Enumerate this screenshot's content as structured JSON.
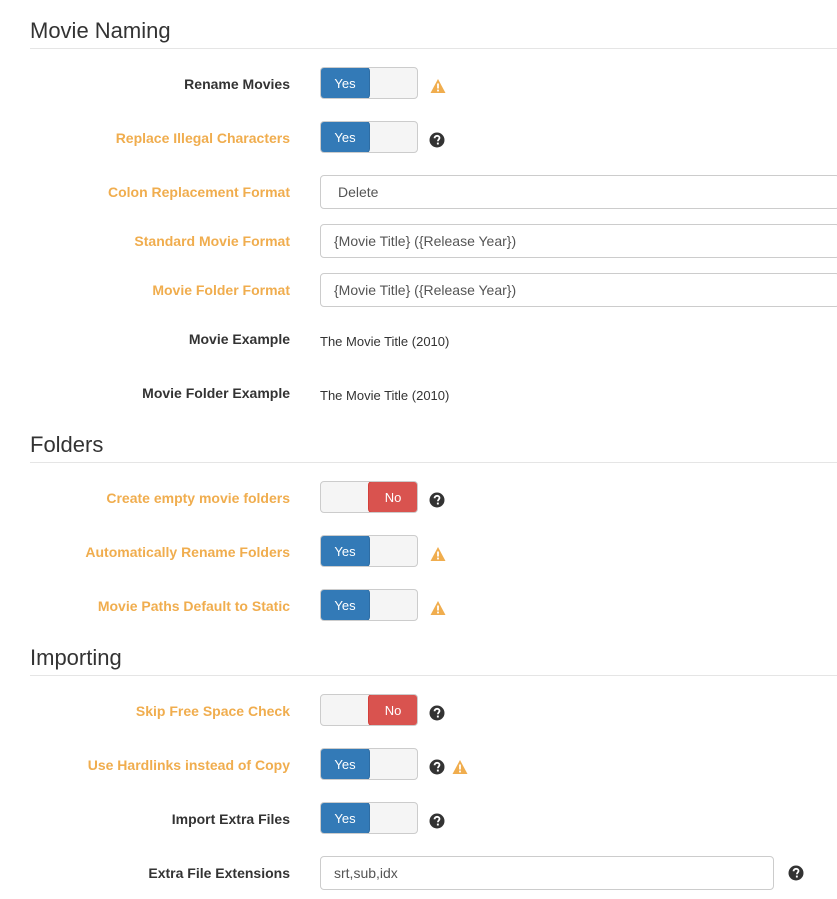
{
  "sections": {
    "naming": "Movie Naming",
    "folders": "Folders",
    "importing": "Importing"
  },
  "naming": {
    "rename_movies": {
      "label": "Rename Movies",
      "toggle": "Yes"
    },
    "replace_illegal": {
      "label": "Replace Illegal Characters",
      "toggle": "Yes"
    },
    "colon_replacement": {
      "label": "Colon Replacement Format",
      "value": "Delete"
    },
    "standard_format": {
      "label": "Standard Movie Format",
      "value": "{Movie Title} ({Release Year})"
    },
    "folder_format": {
      "label": "Movie Folder Format",
      "value": "{Movie Title} ({Release Year})"
    },
    "movie_example": {
      "label": "Movie Example",
      "value": "The Movie Title (2010)"
    },
    "folder_example": {
      "label": "Movie Folder Example",
      "value": "The Movie Title (2010)"
    }
  },
  "folders": {
    "create_empty": {
      "label": "Create empty movie folders",
      "toggle": "No"
    },
    "auto_rename": {
      "label": "Automatically Rename Folders",
      "toggle": "Yes"
    },
    "paths_static": {
      "label": "Movie Paths Default to Static",
      "toggle": "Yes"
    }
  },
  "importing": {
    "skip_free_space": {
      "label": "Skip Free Space Check",
      "toggle": "No"
    },
    "hardlinks": {
      "label": "Use Hardlinks instead of Copy",
      "toggle": "Yes"
    },
    "extra_files": {
      "label": "Import Extra Files",
      "toggle": "Yes"
    },
    "extra_extensions": {
      "label": "Extra File Extensions",
      "value": "srt,sub,idx"
    }
  },
  "colors": {
    "advanced_label": "#f0ad4e",
    "yes": "#337ab7",
    "no": "#d9534f",
    "warning": "#f0ad4e"
  },
  "icons": {
    "warning": "warning-icon",
    "help": "help-icon"
  }
}
